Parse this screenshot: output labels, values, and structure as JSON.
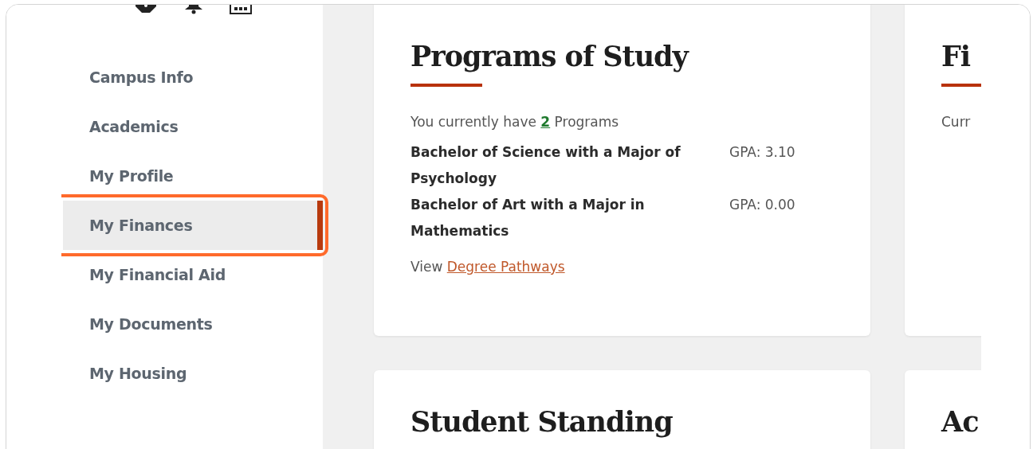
{
  "sidebar": {
    "items": [
      {
        "label": "Campus Info",
        "selected": false,
        "highlighted": false
      },
      {
        "label": "Academics",
        "selected": false,
        "highlighted": false
      },
      {
        "label": "My Profile",
        "selected": false,
        "highlighted": false
      },
      {
        "label": "My Finances",
        "selected": true,
        "highlighted": true
      },
      {
        "label": "My Financial Aid",
        "selected": false,
        "highlighted": false
      },
      {
        "label": "My Documents",
        "selected": false,
        "highlighted": false
      },
      {
        "label": "My Housing",
        "selected": false,
        "highlighted": false
      }
    ]
  },
  "cards": [
    {
      "title": "Programs of Study",
      "summary": {
        "prefix": "You currently have",
        "count": "2",
        "suffix": "Programs"
      },
      "programs": [
        {
          "name": "Bachelor of Science with a Major of Psychology",
          "gpa": "GPA: 3.10"
        },
        {
          "name": "Bachelor of Art with a Major in Mathematics",
          "gpa": "GPA: 0.00"
        }
      ],
      "footer": {
        "prefix": "View",
        "link": "Degree Pathways"
      }
    },
    {
      "title": "Fi",
      "summary": {
        "prefix": "Curr"
      }
    },
    {
      "title": "Student Standing"
    },
    {
      "title": "Ac"
    }
  ]
}
